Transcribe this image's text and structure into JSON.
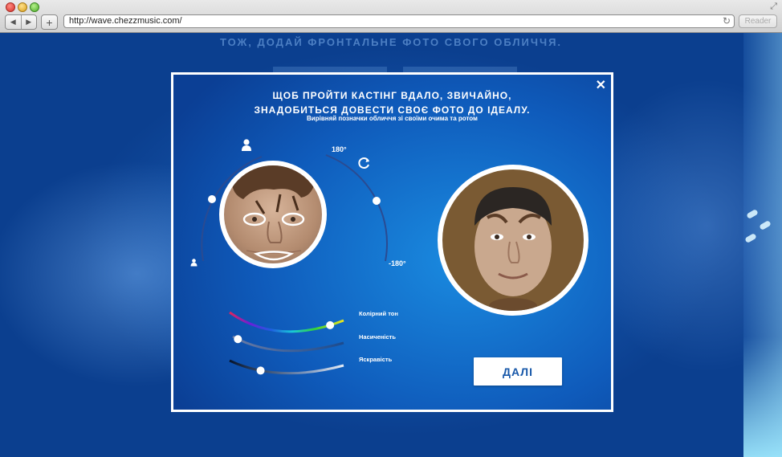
{
  "browser": {
    "url": "http://wave.chezzmusic.com/",
    "reader_label": "Reader",
    "back_glyph": "◀",
    "forward_glyph": "▶",
    "add_glyph": "+",
    "reload_glyph": "↻",
    "fullscreen_glyph": "⤢"
  },
  "page": {
    "heading": "ТОЖ, ДОДАЙ ФРОНТАЛЬНЕ ФОТО СВОГО ОБЛИЧЧЯ."
  },
  "modal": {
    "close_glyph": "✕",
    "title_line1": "ЩОБ ПРОЙТИ КАСТІНГ ВДАЛО, ЗВИЧАЙНО,",
    "title_line2": "ЗНАДОБИТЬСЯ ДОВЕСТИ СВОЄ ФОТО ДО ІДЕАЛУ.",
    "subtitle": "Вирівняй позначки обличчя зі своїми очима та ротом",
    "rotation": {
      "max_label": "180°",
      "min_label": "-180°"
    },
    "sliders": [
      {
        "label": "Колірний тон",
        "value": 0.88
      },
      {
        "label": "Насиченість",
        "value": 0.05
      },
      {
        "label": "Яскравість",
        "value": 0.28
      }
    ],
    "zoom_value": 0.55,
    "rotation_value": 0.42,
    "next_label": "ДАЛІ"
  },
  "colors": {
    "modal_bg": "#1a8be0",
    "accent_text": "#1858a9",
    "preview_bg": "#7a5a33",
    "skin": "#c9a88e"
  }
}
